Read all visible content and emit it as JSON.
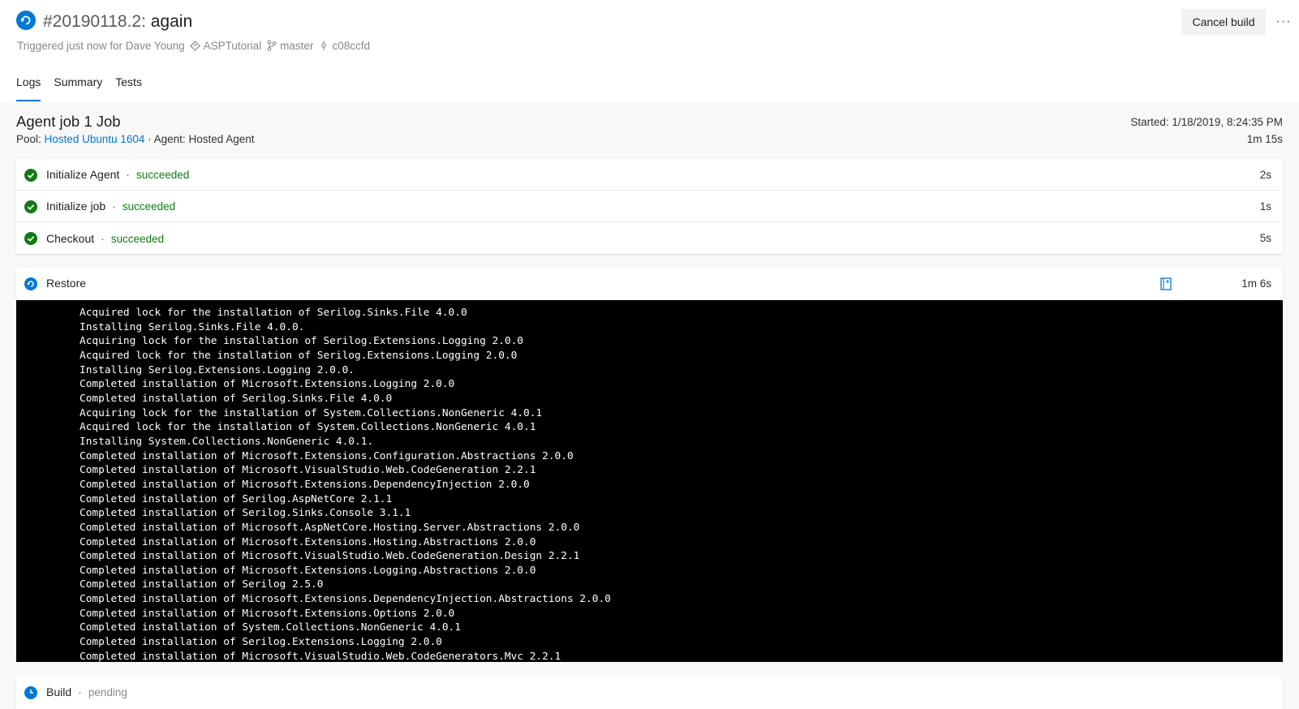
{
  "header": {
    "build_number": "#20190118.2:",
    "build_name": "again",
    "triggered_text": "Triggered just now for Dave Young",
    "project": "ASPTutorial",
    "branch": "master",
    "commit": "c08ccfd",
    "cancel_label": "Cancel build",
    "more_label": "···"
  },
  "tabs": [
    {
      "label": "Logs",
      "active": true
    },
    {
      "label": "Summary",
      "active": false
    },
    {
      "label": "Tests",
      "active": false
    }
  ],
  "job": {
    "title": "Agent job 1 Job",
    "pool_label": "Pool:",
    "pool_name": "Hosted Ubuntu 1604",
    "agent_text": "· Agent: Hosted Agent",
    "started": "Started: 1/18/2019, 8:24:35 PM",
    "duration": "1m 15s"
  },
  "steps": [
    {
      "name": "Initialize Agent",
      "separator": "·",
      "state": "succeeded",
      "time": "2s"
    },
    {
      "name": "Initialize job",
      "separator": "·",
      "state": "succeeded",
      "time": "1s"
    },
    {
      "name": "Checkout",
      "separator": "·",
      "state": "succeeded",
      "time": "5s"
    }
  ],
  "restore": {
    "name": "Restore",
    "time": "1m 6s"
  },
  "console_lines": [
    "Acquired lock for the installation of Serilog.Sinks.File 4.0.0",
    "Installing Serilog.Sinks.File 4.0.0.",
    "Acquiring lock for the installation of Serilog.Extensions.Logging 2.0.0",
    "Acquired lock for the installation of Serilog.Extensions.Logging 2.0.0",
    "Installing Serilog.Extensions.Logging 2.0.0.",
    "Completed installation of Microsoft.Extensions.Logging 2.0.0",
    "Completed installation of Serilog.Sinks.File 4.0.0",
    "Acquiring lock for the installation of System.Collections.NonGeneric 4.0.1",
    "Acquired lock for the installation of System.Collections.NonGeneric 4.0.1",
    "Installing System.Collections.NonGeneric 4.0.1.",
    "Completed installation of Microsoft.Extensions.Configuration.Abstractions 2.0.0",
    "Completed installation of Microsoft.VisualStudio.Web.CodeGeneration 2.2.1",
    "Completed installation of Microsoft.Extensions.DependencyInjection 2.0.0",
    "Completed installation of Serilog.AspNetCore 2.1.1",
    "Completed installation of Serilog.Sinks.Console 3.1.1",
    "Completed installation of Microsoft.AspNetCore.Hosting.Server.Abstractions 2.0.0",
    "Completed installation of Microsoft.Extensions.Hosting.Abstractions 2.0.0",
    "Completed installation of Microsoft.VisualStudio.Web.CodeGeneration.Design 2.2.1",
    "Completed installation of Microsoft.Extensions.Logging.Abstractions 2.0.0",
    "Completed installation of Serilog 2.5.0",
    "Completed installation of Microsoft.Extensions.DependencyInjection.Abstractions 2.0.0",
    "Completed installation of Microsoft.Extensions.Options 2.0.0",
    "Completed installation of System.Collections.NonGeneric 4.0.1",
    "Completed installation of Serilog.Extensions.Logging 2.0.0",
    "Completed installation of Microsoft.VisualStudio.Web.CodeGenerators.Mvc 2.2.1"
  ],
  "build_step": {
    "name": "Build",
    "separator": "·",
    "state": "pending"
  },
  "colors": {
    "accent": "#0078d4",
    "success": "#107c10",
    "console_bg": "#000000"
  },
  "icons": [
    "running-status-icon",
    "repo-icon",
    "branch-icon",
    "commit-icon",
    "success-check-icon",
    "expand-log-icon",
    "pending-status-icon"
  ]
}
